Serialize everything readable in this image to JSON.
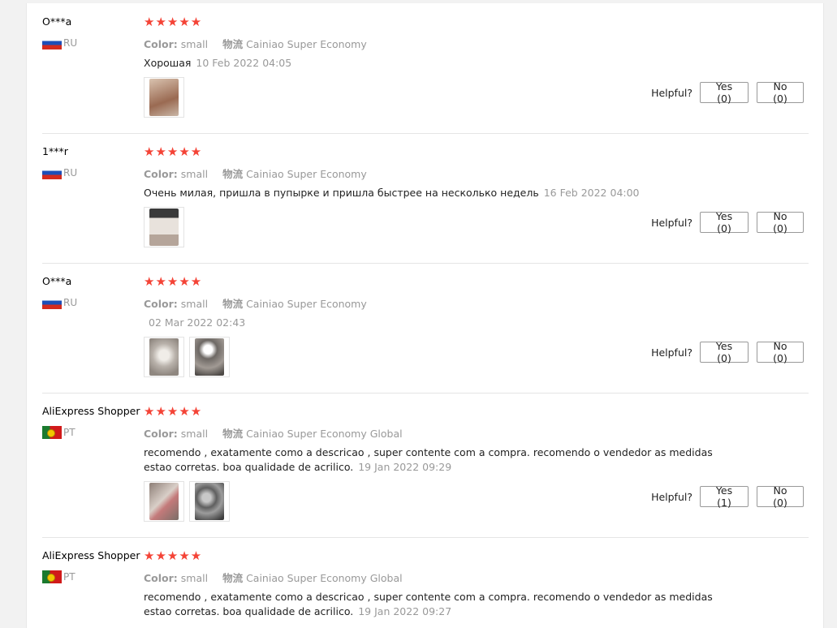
{
  "labels": {
    "color_label": "Color:",
    "shipping_label": "物流",
    "helpful_label": "Helpful?"
  },
  "colors": {
    "star": "#f44336",
    "muted_text": "#999999"
  },
  "reviews": [
    {
      "user": "O***a",
      "country": "RU",
      "flag_icon": "russia-flag-icon",
      "stars": "★★★★★",
      "rating": 5,
      "color": "small",
      "shipping": "Cainiao Super Economy",
      "text": "Хорошая",
      "date": "10 Feb 2022 04:05",
      "yes": "Yes (0)",
      "no": "No (0)",
      "photo_count": 1
    },
    {
      "user": "1***r",
      "country": "RU",
      "flag_icon": "russia-flag-icon",
      "stars": "★★★★★",
      "rating": 5,
      "color": "small",
      "shipping": "Cainiao Super Economy",
      "text": "Очень милая, пришла в пупырке и пришла быстрее на несколько недель",
      "date": "16 Feb 2022 04:00",
      "yes": "Yes (0)",
      "no": "No (0)",
      "photo_count": 1
    },
    {
      "user": "O***a",
      "country": "RU",
      "flag_icon": "russia-flag-icon",
      "stars": "★★★★★",
      "rating": 5,
      "color": "small",
      "shipping": "Cainiao Super Economy",
      "text": "",
      "date": "02 Mar 2022 02:43",
      "yes": "Yes (0)",
      "no": "No (0)",
      "photo_count": 2
    },
    {
      "user": "AliExpress Shopper",
      "country": "PT",
      "flag_icon": "portugal-flag-icon",
      "stars": "★★★★★",
      "rating": 5,
      "color": "small",
      "shipping": "Cainiao Super Economy Global",
      "text": "recomendo , exatamente como a descricao , super contente com a compra. recomendo o vendedor as medidas estao corretas. boa qualidade de acrilico.",
      "date": "19 Jan 2022 09:29",
      "yes": "Yes (1)",
      "no": "No (0)",
      "photo_count": 2
    },
    {
      "user": "AliExpress Shopper",
      "country": "PT",
      "flag_icon": "portugal-flag-icon",
      "stars": "★★★★★",
      "rating": 5,
      "color": "small",
      "shipping": "Cainiao Super Economy Global",
      "text": "recomendo , exatamente como a descricao , super contente com a compra. recomendo o vendedor as medidas estao corretas. boa qualidade de acrilico.",
      "date": "19 Jan 2022 09:27"
    }
  ]
}
